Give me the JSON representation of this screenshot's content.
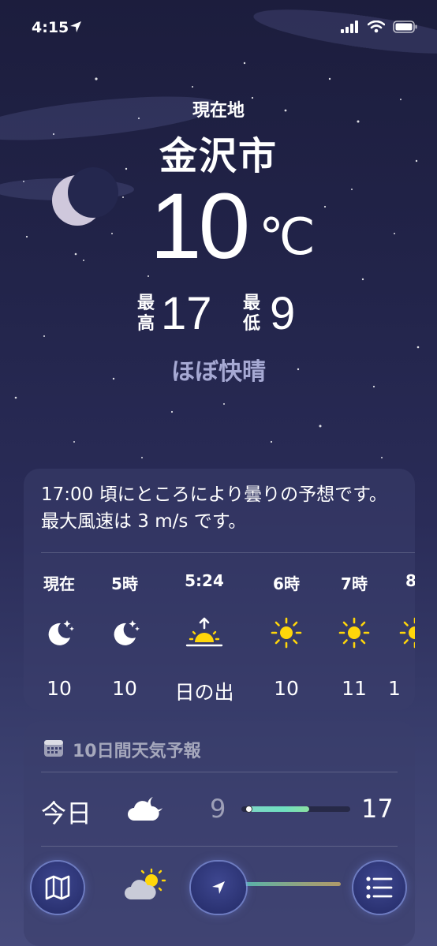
{
  "status": {
    "time": "4:15"
  },
  "header": {
    "location_label": "現在地",
    "city": "金沢市",
    "temperature": "10",
    "unit": "℃",
    "high_label": "最高",
    "high": "17",
    "low_label": "最低",
    "low": "9",
    "condition": "ほぼ快晴"
  },
  "hourly": {
    "summary": "17:00 頃にところにより曇りの予想です。最大風速は 3 m/s です。",
    "items": [
      {
        "time": "現在",
        "icon": "moon-stars-icon",
        "value": "10"
      },
      {
        "time": "5時",
        "icon": "moon-stars-icon",
        "value": "10"
      },
      {
        "time": "5:24",
        "icon": "sunrise-icon",
        "value": "日の出"
      },
      {
        "time": "6時",
        "icon": "sun-icon",
        "value": "10"
      },
      {
        "time": "7時",
        "icon": "sun-icon",
        "value": "11"
      },
      {
        "time": "8",
        "icon": "sun-icon",
        "value": "1"
      }
    ]
  },
  "forecast": {
    "title": "10日間天気予報",
    "rows": [
      {
        "day": "今日",
        "icon": "cloud-moon-icon",
        "low": "9",
        "high": "17",
        "bar_start": 0.0,
        "bar_end": 0.58
      }
    ]
  },
  "colors": {
    "sun": "#ffd60a",
    "background_top": "#1c1d3d",
    "bar": "#7fd6c6"
  }
}
